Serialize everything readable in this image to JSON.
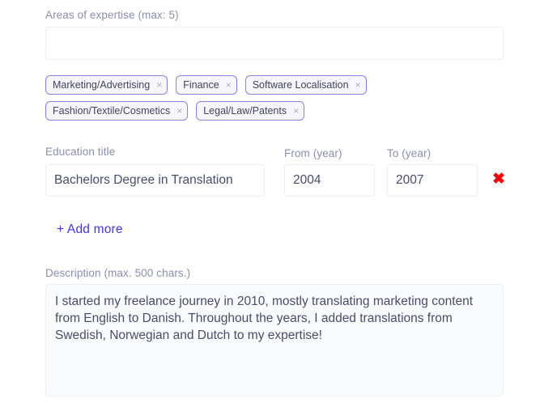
{
  "expertise": {
    "label": "Areas of expertise (max: 5)",
    "input_value": "",
    "input_placeholder": "",
    "remove_icon": "×",
    "chips": [
      {
        "label": "Marketing/Advertising"
      },
      {
        "label": "Finance"
      },
      {
        "label": "Software Localisation"
      },
      {
        "label": "Fashion/Textile/Cosmetics"
      },
      {
        "label": "Legal/Law/Patents"
      }
    ]
  },
  "education": {
    "title_label": "Education title",
    "from_label": "From (year)",
    "to_label": "To (year)",
    "title_value": "Bachelors Degree in Translation",
    "from_value": "2004",
    "to_value": "2007",
    "title_placeholder": "",
    "from_placeholder": "",
    "to_placeholder": "",
    "delete_icon": "✖",
    "add_more_label": "+ Add more"
  },
  "description": {
    "label": "Description (max. 500 chars.)",
    "value": "I started my freelance journey in 2010, mostly translating marketing content from English to Danish. Throughout the years, I added translations from Swedish, Norwegian and Dutch to my expertise!",
    "placeholder": ""
  },
  "colors": {
    "accent": "#4233e8",
    "chip_border": "#8b7fe8",
    "chip_background": "#f7f6fd",
    "label_text": "#8b8fb0",
    "input_text": "#474d6b",
    "input_border": "#eceef4",
    "delete_red": "#fa0000",
    "textarea_background": "#fafbfc",
    "page_background": "#ffffff"
  }
}
